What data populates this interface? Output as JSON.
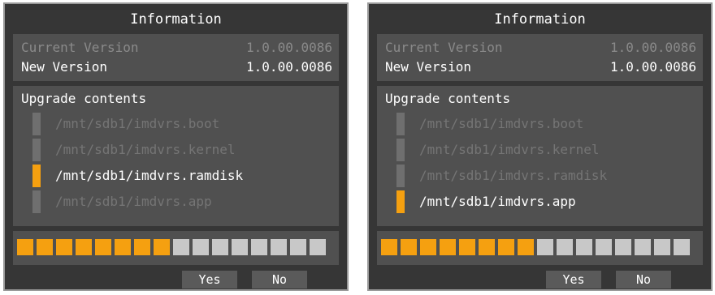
{
  "dialogs": [
    {
      "title": "Information",
      "current_version_label": "Current Version",
      "current_version_value": "1.0.00.0086",
      "new_version_label": "New Version",
      "new_version_value": "1.0.00.0086",
      "contents_label": "Upgrade contents",
      "files": [
        {
          "path": "/mnt/sdb1/imdvrs.boot",
          "active": false
        },
        {
          "path": "/mnt/sdb1/imdvrs.kernel",
          "active": false
        },
        {
          "path": "/mnt/sdb1/imdvrs.ramdisk",
          "active": true
        },
        {
          "path": "/mnt/sdb1/imdvrs.app",
          "active": false
        }
      ],
      "progress": {
        "filled_segments": 8,
        "total_segments": 16
      },
      "yes_label": "Yes",
      "no_label": "No"
    },
    {
      "title": "Information",
      "current_version_label": "Current Version",
      "current_version_value": "1.0.00.0086",
      "new_version_label": "New Version",
      "new_version_value": "1.0.00.0086",
      "contents_label": "Upgrade contents",
      "files": [
        {
          "path": "/mnt/sdb1/imdvrs.boot",
          "active": false
        },
        {
          "path": "/mnt/sdb1/imdvrs.kernel",
          "active": false
        },
        {
          "path": "/mnt/sdb1/imdvrs.ramdisk",
          "active": false
        },
        {
          "path": "/mnt/sdb1/imdvrs.app",
          "active": true
        }
      ],
      "progress": {
        "filled_segments": 8,
        "total_segments": 16
      },
      "yes_label": "Yes",
      "no_label": "No"
    }
  ],
  "colors": {
    "accent": "#f5a010",
    "background": "#363636",
    "panel": "#505050",
    "inactive_indicator": "#6f6f6f",
    "empty_segment": "#c8c8c8"
  }
}
